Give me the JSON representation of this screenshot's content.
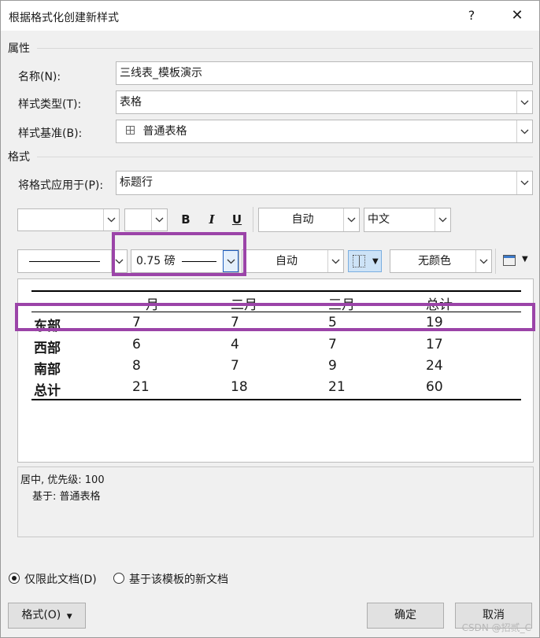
{
  "window": {
    "title": "根据格式化创建新样式",
    "help_label": "?",
    "close_label": "✕"
  },
  "properties": {
    "section_label": "属性",
    "name_label": "名称(N):",
    "name_value": "三线表_模板演示",
    "type_label": "样式类型(T):",
    "type_value": "表格",
    "based_on_label": "样式基准(B):",
    "based_on_value": "普通表格"
  },
  "format": {
    "section_label": "格式",
    "apply_to_label": "将格式应用于(P):",
    "apply_to_value": "标题行",
    "font_value": "",
    "size_value": "",
    "bold_label": "B",
    "italic_label": "I",
    "underline_label": "U",
    "font_color_value": "自动",
    "script_value": "中文",
    "border_weight_value": "0.75 磅",
    "border_color_value": "自动",
    "shading_value": "无颜色"
  },
  "preview": {
    "columns": [
      "",
      "一月",
      "二月",
      "三月",
      "总计"
    ],
    "rows": [
      [
        "东部",
        "7",
        "7",
        "5",
        "19"
      ],
      [
        "西部",
        "6",
        "4",
        "7",
        "17"
      ],
      [
        "南部",
        "8",
        "7",
        "9",
        "24"
      ],
      [
        "总计",
        "21",
        "18",
        "21",
        "60"
      ]
    ]
  },
  "description": {
    "line1": "居中, 优先级: 100",
    "line2": "基于: 普通表格"
  },
  "scope": {
    "only_this_doc_label": "仅限此文档(D)",
    "new_docs_label": "基于该模板的新文档"
  },
  "buttons": {
    "format_label": "格式(O)",
    "ok_label": "确定",
    "cancel_label": "取消"
  },
  "watermark": "CSDN @招贰_C",
  "colors": {
    "highlight": "#9b44a8",
    "accent": "#1f5fbf"
  }
}
